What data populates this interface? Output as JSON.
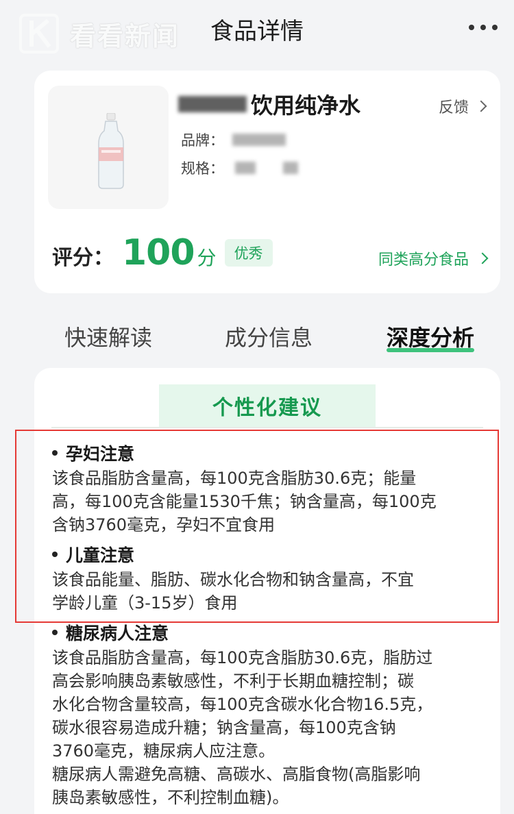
{
  "header": {
    "watermark": "看看新闻",
    "title": "食品详情",
    "more_icon": "more-dots-icon"
  },
  "product": {
    "name": "饮用纯净水",
    "feedback_label": "反馈",
    "brand_label": "品牌：",
    "spec_label": "规格：",
    "score_label": "评分：",
    "score_value": "100",
    "score_unit": "分",
    "score_badge": "优秀",
    "similar_link": "同类高分食品",
    "accent_color": "#1fa35a"
  },
  "tabs": [
    {
      "label": "快速解读",
      "active": false
    },
    {
      "label": "成分信息",
      "active": false
    },
    {
      "label": "深度分析",
      "active": true
    }
  ],
  "advice": {
    "section_title": "个性化建议",
    "items": [
      {
        "title": "孕妇注意",
        "body": [
          "该食品脂肪含量高，每100克含脂肪30.6克；能量",
          "高，每100克含能量1530千焦；钠含量高，每100克",
          "含钠3760毫克，孕妇不宜食用"
        ]
      },
      {
        "title": "儿童注意",
        "body": [
          "该食品能量、脂肪、碳水化合物和钠含量高，不宜",
          "学龄儿童（3-15岁）食用"
        ]
      },
      {
        "title": "糖尿病人注意",
        "body": [
          "该食品脂肪含量高，每100克含脂肪30.6克，脂肪过",
          "高会影响胰岛素敏感性，不利于长期血糖控制；碳",
          "水化合物含量较高，每100克含碳水化合物16.5克，",
          "碳水很容易造成升糖；钠含量高，每100克含钠",
          "3760毫克，糖尿病人应注意。",
          "糖尿病人需避免高糖、高碳水、高脂食物(高脂影响",
          "胰岛素敏感性，不利控制血糖)。"
        ]
      }
    ]
  },
  "highlight_color": "#e53935"
}
